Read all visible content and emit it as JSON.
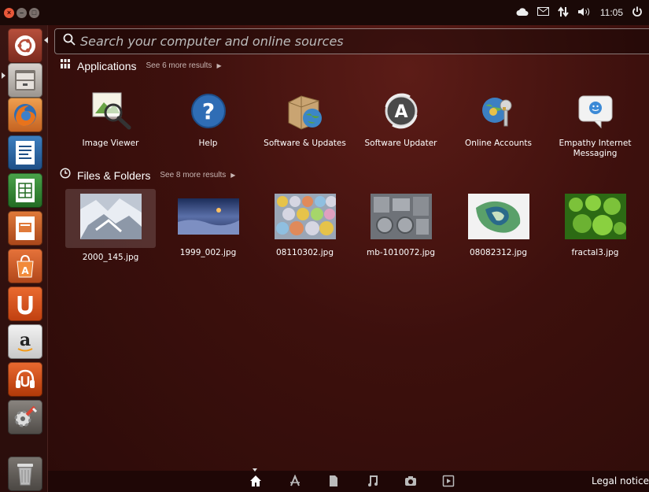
{
  "top_panel": {
    "window_buttons": [
      "close",
      "minimize",
      "maximize"
    ],
    "indicators": [
      "cloud-icon",
      "mail-icon",
      "network-icon",
      "volume-icon"
    ],
    "time": "11:05",
    "power_icon": "power-icon"
  },
  "launcher": {
    "items": [
      {
        "name": "dash-home",
        "icon": "ubuntu-logo-icon"
      },
      {
        "name": "files",
        "icon": "file-cabinet-icon"
      },
      {
        "name": "firefox",
        "icon": "firefox-icon"
      },
      {
        "name": "libreoffice-writer",
        "icon": "writer-icon"
      },
      {
        "name": "libreoffice-calc",
        "icon": "calc-icon"
      },
      {
        "name": "libreoffice-impress",
        "icon": "impress-icon"
      },
      {
        "name": "software-center",
        "icon": "software-center-icon"
      },
      {
        "name": "ubuntu-one",
        "icon": "ubuntu-one-icon"
      },
      {
        "name": "amazon",
        "icon": "amazon-icon"
      },
      {
        "name": "ubuntu-one-music",
        "icon": "ubuntu-one-music-icon"
      },
      {
        "name": "system-settings",
        "icon": "settings-icon"
      },
      {
        "name": "trash",
        "icon": "trash-icon"
      }
    ]
  },
  "search": {
    "placeholder": "Search your computer and online sources",
    "value": ""
  },
  "applications": {
    "title": "Applications",
    "more": "See 6 more results",
    "items": [
      {
        "label": "Image Viewer",
        "icon": "image-viewer-icon"
      },
      {
        "label": "Help",
        "icon": "help-icon"
      },
      {
        "label": "Software & Updates",
        "icon": "software-updates-icon"
      },
      {
        "label": "Software Updater",
        "icon": "software-updater-icon"
      },
      {
        "label": "Online Accounts",
        "icon": "online-accounts-icon"
      },
      {
        "label": "Empathy Internet Messaging",
        "icon": "empathy-icon"
      }
    ]
  },
  "files": {
    "title": "Files & Folders",
    "more": "See 8 more results",
    "items": [
      {
        "label": "2000_145.jpg"
      },
      {
        "label": "1999_002.jpg"
      },
      {
        "label": "08110302.jpg"
      },
      {
        "label": "mb-1010072.jpg"
      },
      {
        "label": "08082312.jpg"
      },
      {
        "label": "fractal3.jpg"
      }
    ]
  },
  "filter_bar": {
    "lenses": [
      "home-lens-icon",
      "applications-lens-icon",
      "files-lens-icon",
      "music-lens-icon",
      "photos-lens-icon",
      "video-lens-icon"
    ],
    "legal": "Legal notice"
  },
  "colors": {
    "accent": "#e8583a",
    "dash_bg": "#3d100d",
    "panel_bg": "#1a0907"
  }
}
